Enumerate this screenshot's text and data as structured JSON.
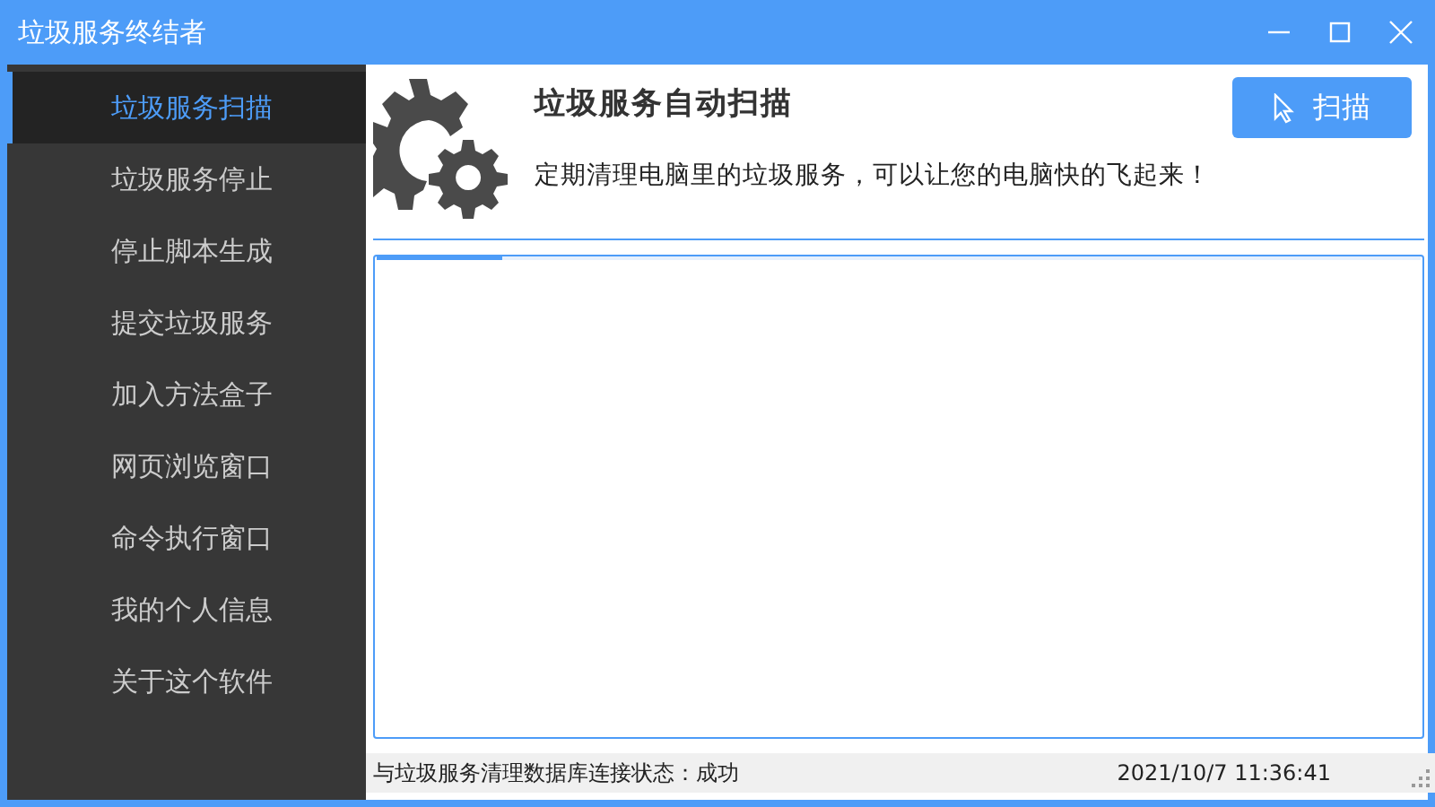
{
  "window": {
    "title": "垃圾服务终结者"
  },
  "sidebar": {
    "items": [
      {
        "label": "垃圾服务扫描",
        "selected": true
      },
      {
        "label": "垃圾服务停止",
        "selected": false
      },
      {
        "label": "停止脚本生成",
        "selected": false
      },
      {
        "label": "提交垃圾服务",
        "selected": false
      },
      {
        "label": "加入方法盒子",
        "selected": false
      },
      {
        "label": "网页浏览窗口",
        "selected": false
      },
      {
        "label": "命令执行窗口",
        "selected": false
      },
      {
        "label": "我的个人信息",
        "selected": false
      },
      {
        "label": "关于这个软件",
        "selected": false
      }
    ]
  },
  "header": {
    "title": "垃圾服务自动扫描",
    "description": "定期清理电脑里的垃圾服务，可以让您的电脑快的飞起来！",
    "button": "扫描"
  },
  "output": {
    "progress": {
      "level": 0.12
    }
  },
  "status_bar": {
    "connection": "与垃圾服务清理数据库连接状态：成功",
    "time": "2021/10/7 11:36:41"
  }
}
